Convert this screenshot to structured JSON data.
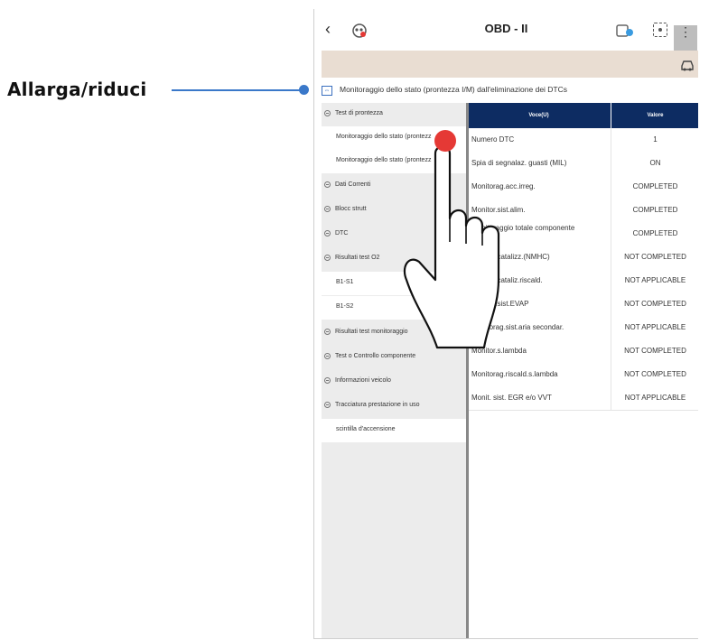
{
  "callout": {
    "label": "Allarga/riduci",
    "color": "#3a78c9"
  },
  "topbar": {
    "title": "OBD - II",
    "back_icon": "‹",
    "menu_icon": "⋮",
    "icons": [
      "back-icon",
      "mascot-icon",
      "vci-icon",
      "screen-capture-icon",
      "menu-icon",
      "car-icon"
    ]
  },
  "path": {
    "text": "Monitoraggio dello stato (prontezza I/M) dall'eliminazione dei DTCs",
    "icon": "collapse-icon"
  },
  "tree": [
    {
      "label": "Test di prontezza",
      "type": "group"
    },
    {
      "label": "Monitoraggio dello stato (prontezz",
      "type": "sub"
    },
    {
      "label": "Monitoraggio dello stato (prontezz",
      "type": "sub"
    },
    {
      "label": "Dati Correnti",
      "type": "group"
    },
    {
      "label": "Blocc strutt",
      "type": "group"
    },
    {
      "label": "DTC",
      "type": "group"
    },
    {
      "label": "Risultati test O2",
      "type": "group"
    },
    {
      "label": "B1-S1",
      "type": "sub"
    },
    {
      "label": "B1-S2",
      "type": "sub"
    },
    {
      "label": "Risultati test monitoraggio",
      "type": "group"
    },
    {
      "label": "Test o Controllo componente",
      "type": "group"
    },
    {
      "label": "Informazioni veicolo",
      "type": "group"
    },
    {
      "label": "Tracciatura prestazione in uso",
      "type": "group"
    },
    {
      "label": "scintilla d'accensione",
      "type": "sub"
    }
  ],
  "table": {
    "headers": [
      "Voce(U)",
      "Valore"
    ],
    "header_color": "#0d2c62",
    "rows": [
      {
        "voce": "Numero DTC",
        "valore": "1"
      },
      {
        "voce": "Spia di segnalaz. guasti (MIL)",
        "valore": "ON"
      },
      {
        "voce": "Monitorag.acc.irreg.",
        "valore": "COMPLETED"
      },
      {
        "voce": "Monitor.sist.alim.",
        "valore": "COMPLETED"
      },
      {
        "voce": "Monitoraggio totale componente",
        "valore": "COMPLETED"
      },
      {
        "voce": "Monitor.catalizz.(NMHC)",
        "valore": "NOT COMPLETED"
      },
      {
        "voce": "Monitor.cataliz.riscald.",
        "valore": "NOT APPLICABLE"
      },
      {
        "voce": "Monitor.sist.EVAP",
        "valore": "NOT COMPLETED"
      },
      {
        "voce": "Monitorag.sist.aria secondar.",
        "valore": "NOT APPLICABLE"
      },
      {
        "voce": "Monitor.s.lambda",
        "valore": "NOT COMPLETED"
      },
      {
        "voce": "Monitorag.riscald.s.lambda",
        "valore": "NOT COMPLETED"
      },
      {
        "voce": "Monit. sist. EGR e/o VVT",
        "valore": "NOT APPLICABLE"
      }
    ]
  },
  "gesture": {
    "icon": "tap-hand-icon",
    "dot_color": "#e53935"
  }
}
